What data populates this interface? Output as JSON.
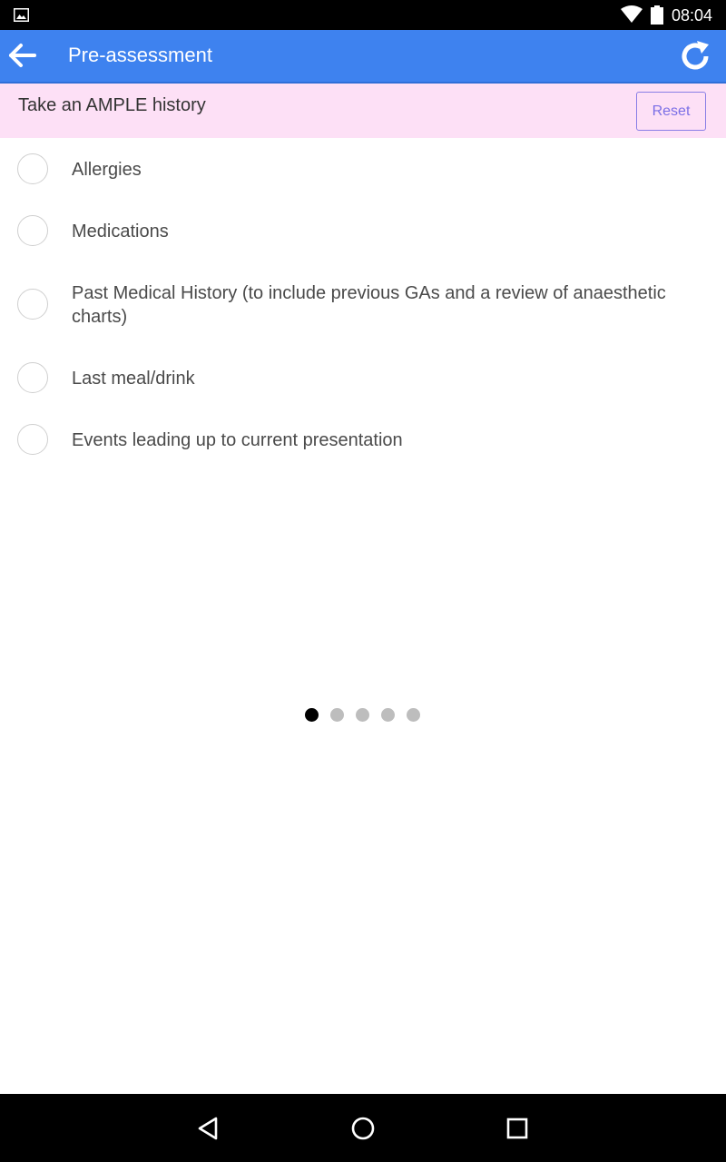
{
  "status_bar": {
    "time": "08:04",
    "icons": [
      "image-icon",
      "wifi-icon",
      "battery-icon"
    ]
  },
  "app_bar": {
    "title": "Pre-assessment",
    "back_icon": "arrow-left-icon",
    "refresh_icon": "refresh-icon",
    "background_color": "#3e82ef"
  },
  "section": {
    "title": "Take an AMPLE history",
    "reset_label": "Reset",
    "background_color": "#fde0f6"
  },
  "checklist": {
    "items": [
      {
        "label": "Allergies",
        "checked": false
      },
      {
        "label": "Medications",
        "checked": false
      },
      {
        "label": "Past Medical History (to include previous GAs and a review of anaesthetic charts)",
        "checked": false
      },
      {
        "label": "Last meal/drink",
        "checked": false
      },
      {
        "label": "Events leading up to current presentation",
        "checked": false
      }
    ]
  },
  "pager": {
    "total_pages": 5,
    "current_page": 1
  },
  "nav_bar": {
    "icons": [
      "back-triangle-icon",
      "home-circle-icon",
      "recents-square-icon"
    ]
  }
}
